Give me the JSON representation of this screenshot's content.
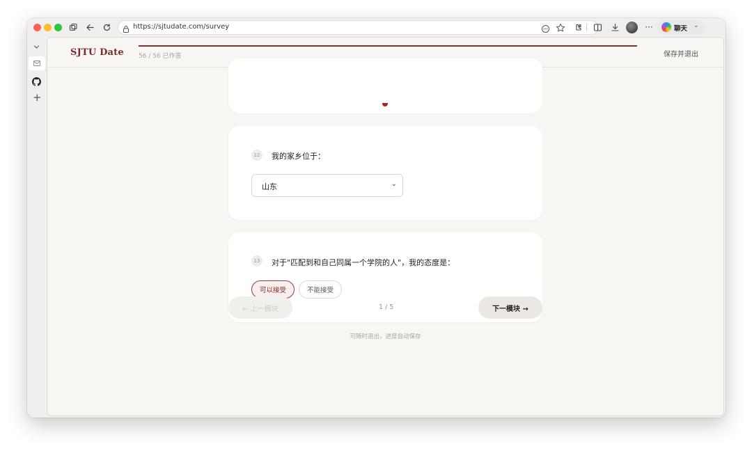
{
  "browser": {
    "url": "https://sjtudate.com/survey",
    "chat_label": "聊天",
    "traffic_colors": {
      "close": "#ff5f57",
      "minimize": "#febc2e",
      "maximize": "#28c840"
    }
  },
  "header": {
    "logo": "SJTU Date",
    "answered": "56 / 56 已作答",
    "progress": 1.0,
    "save_exit": "保存并退出",
    "accent": "#8b2b2b"
  },
  "questions": [
    {
      "number": "12",
      "text": "我的家乡位于：",
      "type": "select",
      "selected": "山东"
    },
    {
      "number": "13",
      "text": "对于\"匹配到和自己同属一个学院的人\"，我的态度是：",
      "type": "choice",
      "options": [
        {
          "label": "可以接受",
          "selected": true
        },
        {
          "label": "不能接受",
          "selected": false
        }
      ]
    }
  ],
  "nav": {
    "prev": "← 上一模块",
    "page": "1 / 5",
    "next": "下一模块 →"
  },
  "footer_note": "可随时退出，进度自动保存"
}
